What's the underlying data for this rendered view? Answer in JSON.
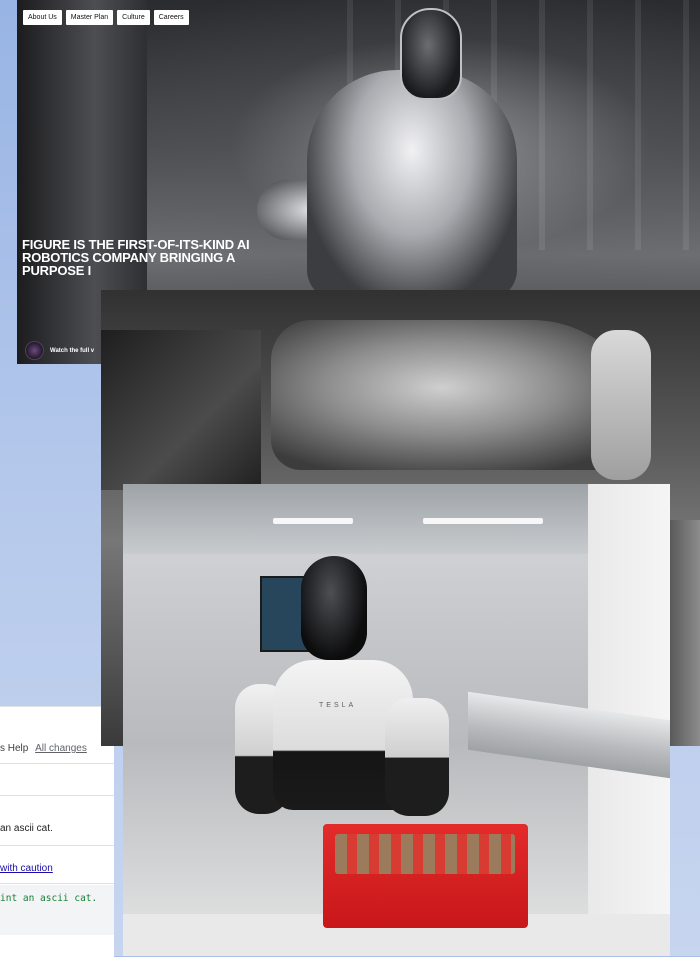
{
  "figure_site": {
    "nav": [
      "About Us",
      "Master Plan",
      "Culture",
      "Careers"
    ],
    "headline": "FIGURE IS THE FIRST-OF-ITS-KIND AI ROBOTICS COMPANY BRINGING A PURPOSE I",
    "video_label": "Watch the full v"
  },
  "editor": {
    "menu_help_prefix": "s  Help",
    "menu_changes_link": "All changes",
    "prompt_text": "an ascii cat.",
    "caution_link": "with caution",
    "code_text": "int an ascii cat."
  },
  "tesla": {
    "logo_text": "TESLA"
  }
}
